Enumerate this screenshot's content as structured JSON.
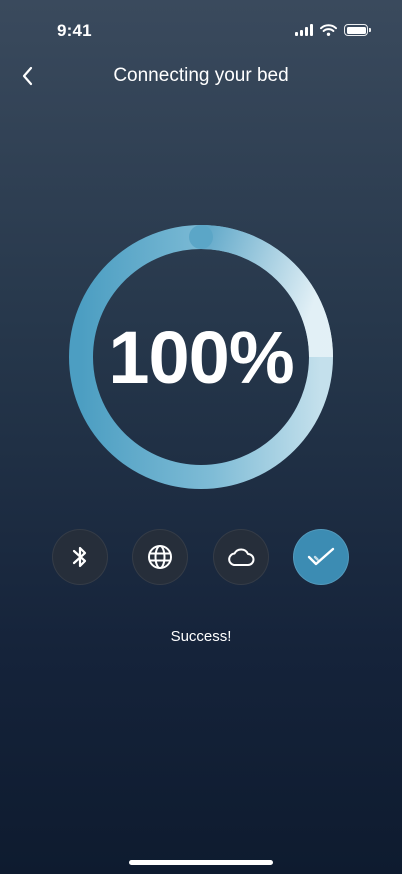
{
  "status_bar": {
    "time": "9:41",
    "icons": [
      "signal-icon",
      "wifi-icon",
      "battery-icon"
    ]
  },
  "header": {
    "back_icon": "chevron-left-icon",
    "title": "Connecting your bed"
  },
  "progress": {
    "label": "100%",
    "value": 1.0,
    "colors": {
      "track_light": "#e8f3f8",
      "arc_start": "#4c9ec2",
      "arc_end": "#b8d8e6"
    }
  },
  "steps": [
    {
      "icon": "bluetooth-icon",
      "state": "done"
    },
    {
      "icon": "globe-icon",
      "state": "done"
    },
    {
      "icon": "cloud-icon",
      "state": "done"
    },
    {
      "icon": "check-icon",
      "state": "active"
    }
  ],
  "message": "Success!",
  "colors": {
    "accent": "#3c8cb3",
    "step_bg": "#262e3a",
    "bg_top": "#3a4a5d",
    "bg_bottom": "#0e1b2f"
  }
}
